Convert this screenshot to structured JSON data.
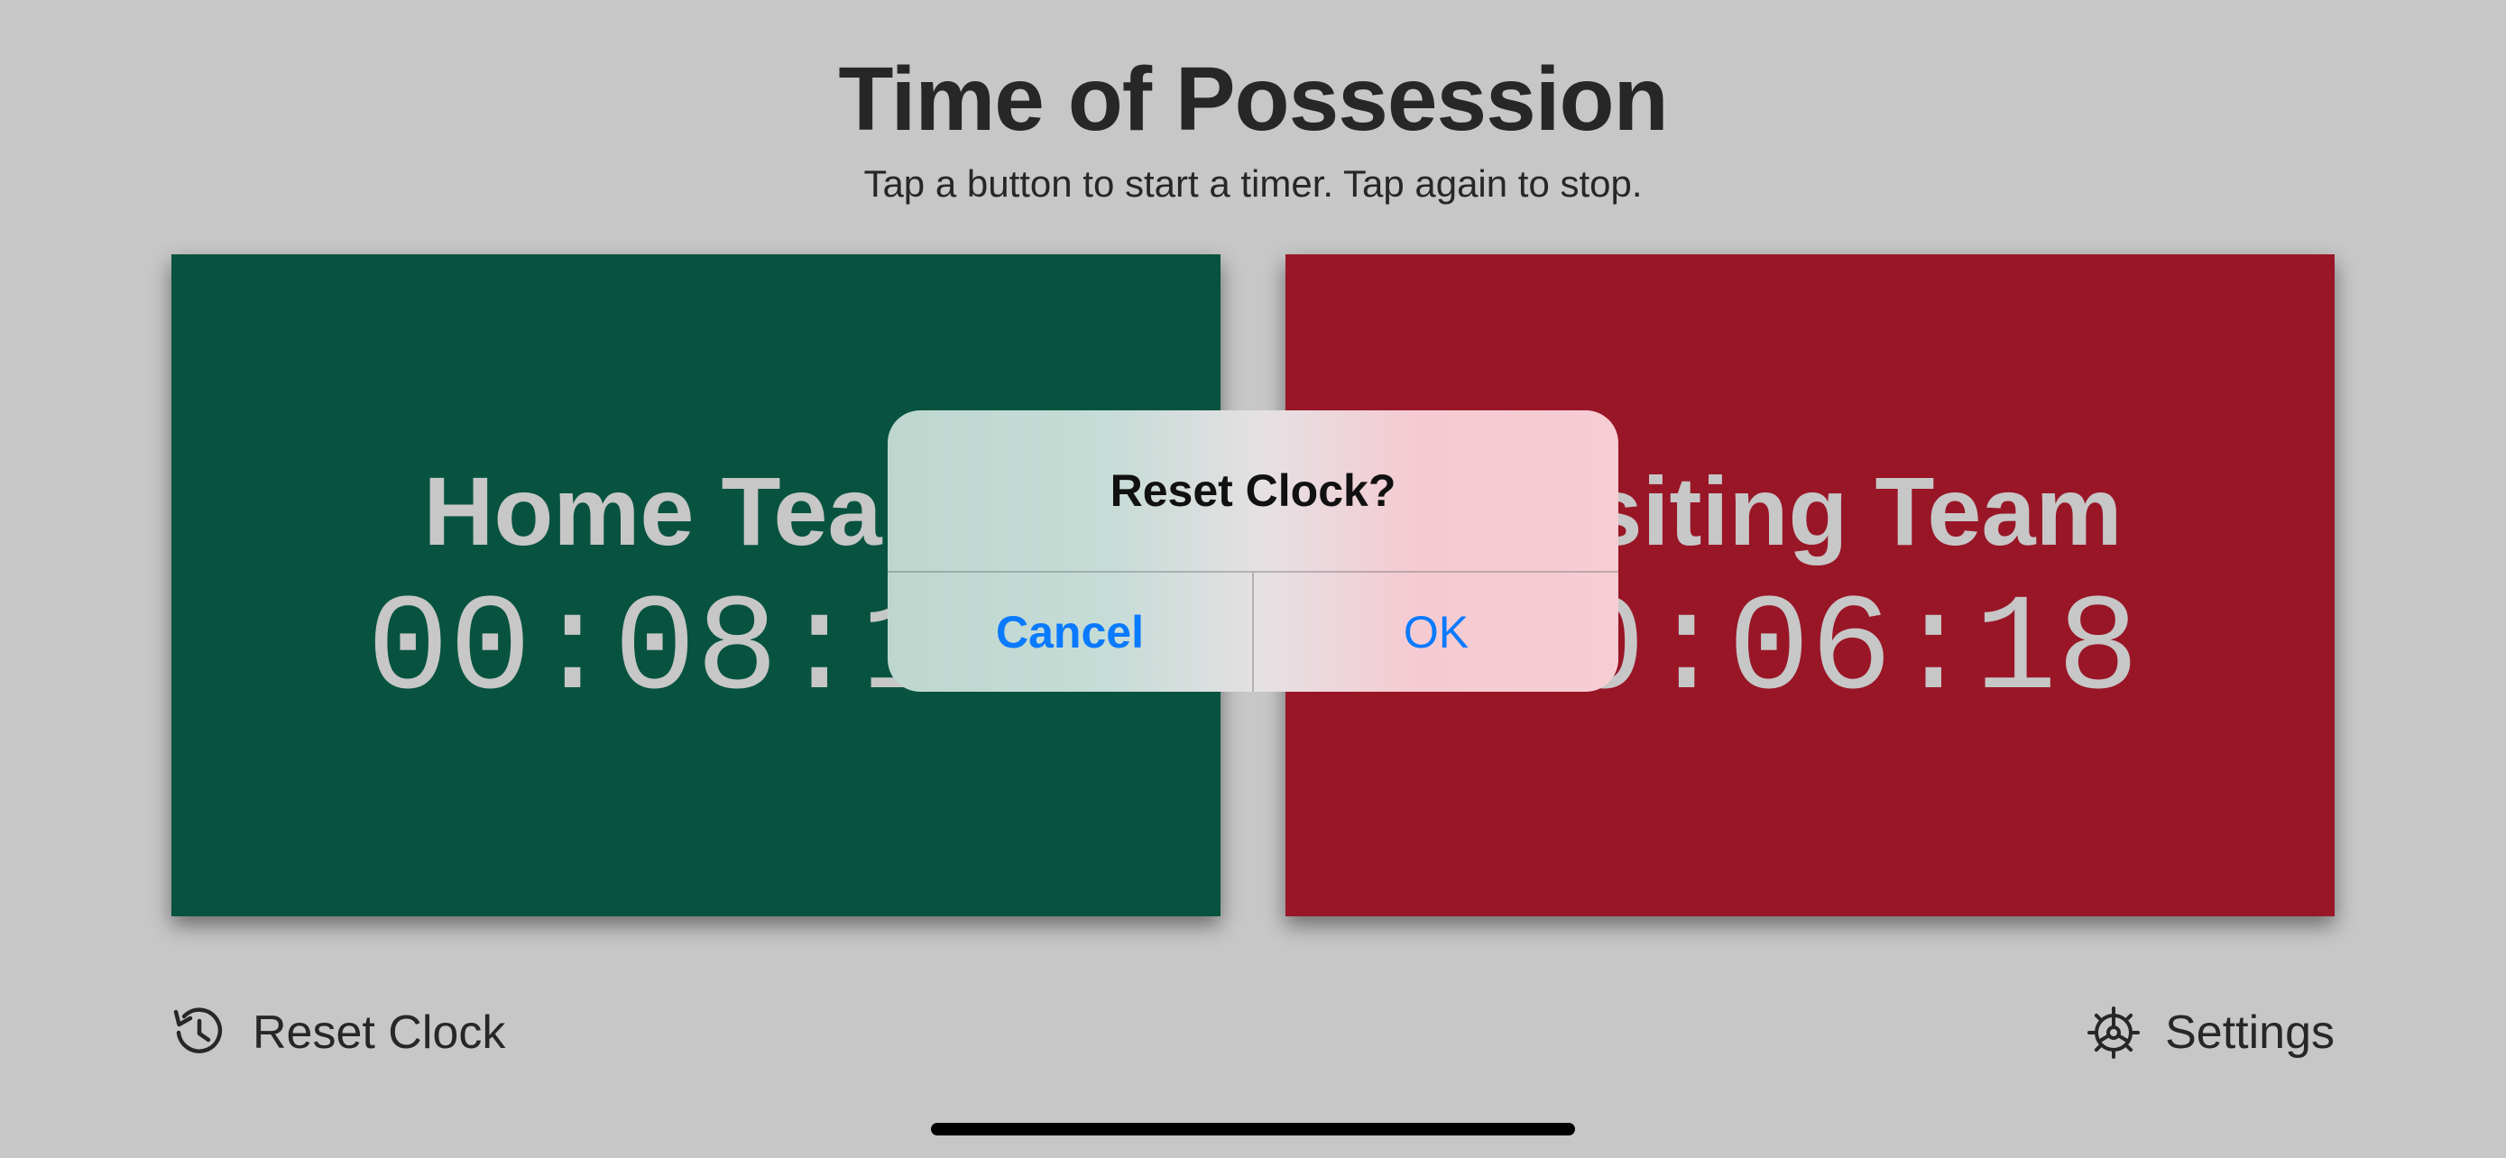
{
  "app": {
    "title": "Time of Possession",
    "subtitle": "Tap a button to start a timer. Tap again to stop."
  },
  "teams": {
    "home": {
      "name": "Home Team",
      "time": "00:08:16",
      "color": "#0b6b52"
    },
    "visiting": {
      "name": "Visiting Team",
      "time": "00:06:18",
      "color": "#c41d33"
    }
  },
  "toolbar": {
    "reset": {
      "label": "Reset Clock",
      "icon": "clock-arrow-counterclockwise-icon"
    },
    "settings": {
      "label": "Settings",
      "icon": "gear-icon"
    }
  },
  "alert": {
    "title": "Reset Clock?",
    "cancel_label": "Cancel",
    "ok_label": "OK"
  },
  "colors": {
    "background": "#ffffff",
    "text": "#333333",
    "accent": "#0a7aff"
  }
}
